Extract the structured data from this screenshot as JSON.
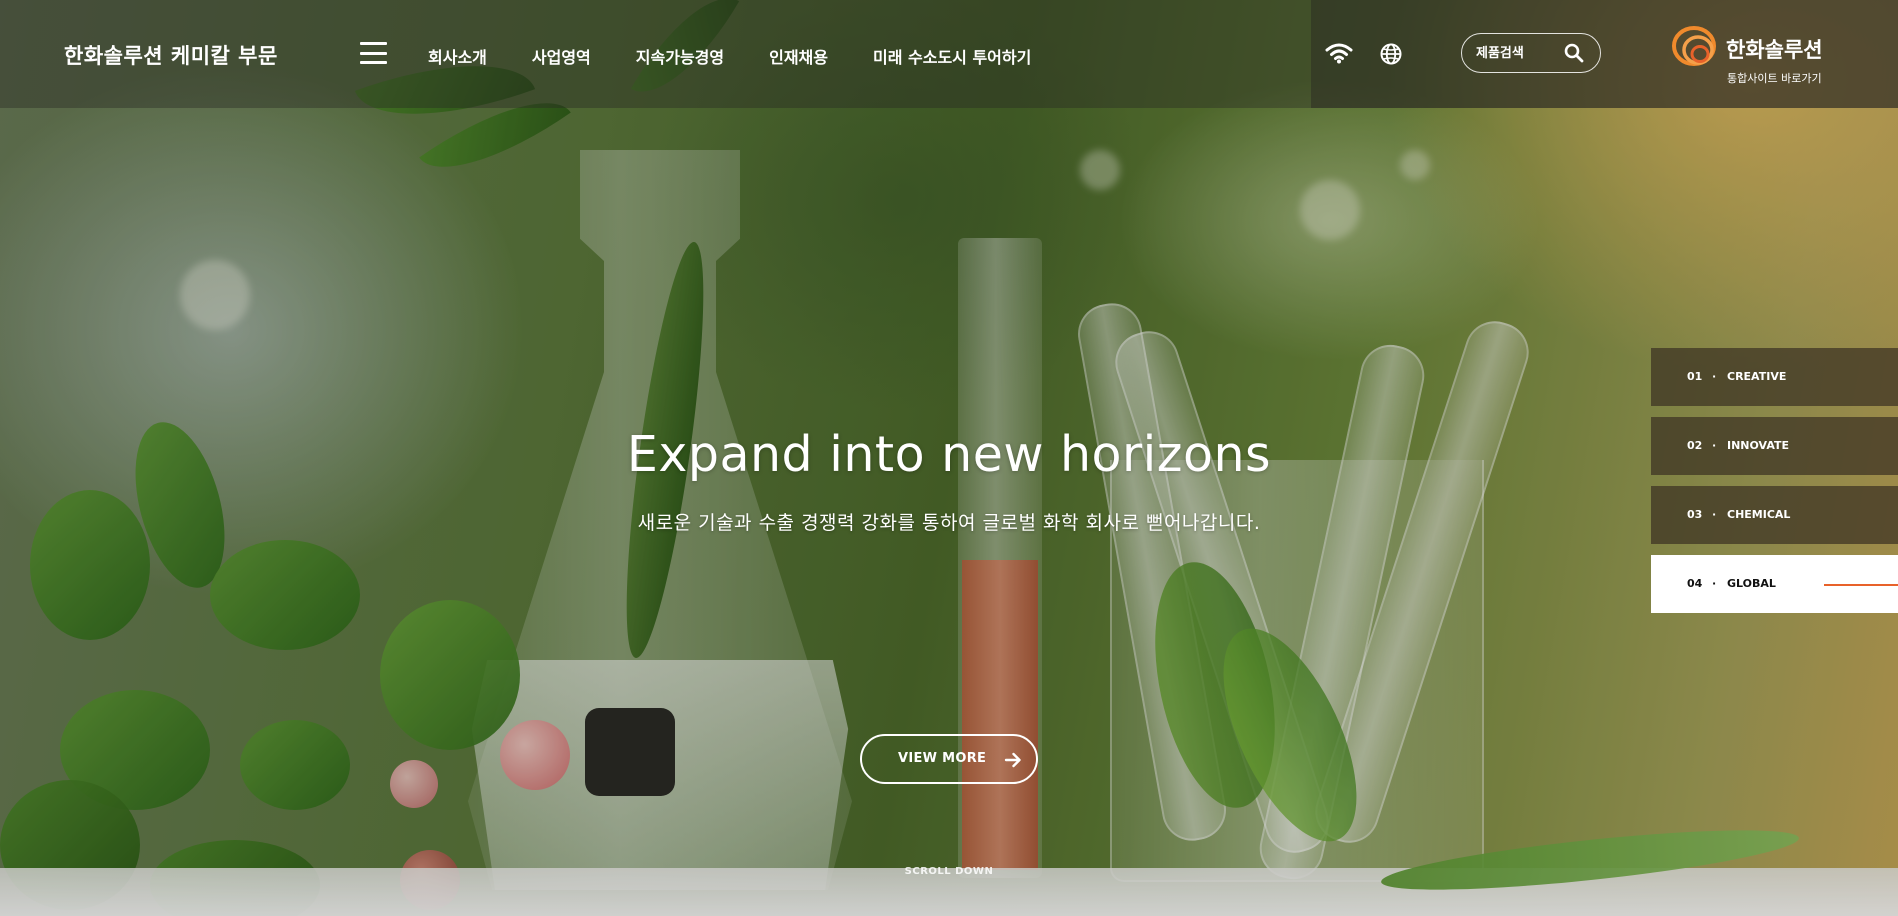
{
  "header": {
    "site_title": "한화솔루션 케미칼 부문",
    "nav": [
      {
        "label": "회사소개"
      },
      {
        "label": "사업영역"
      },
      {
        "label": "지속가능경영"
      },
      {
        "label": "인재채용"
      },
      {
        "label": "미래 수소도시 투어하기"
      }
    ],
    "search": {
      "placeholder": "제품검색"
    },
    "brand": {
      "name": "한화솔루션",
      "sub": "통합사이트 바로가기"
    }
  },
  "hero": {
    "title": "Expand into new horizons",
    "subtitle": "새로운 기술과 수출 경쟁력 강화를 통하여 글로벌 화학 회사로 뻗어나갑니다.",
    "view_more": "VIEW MORE",
    "scroll": "SCROLL DOWN"
  },
  "slides": [
    {
      "num": "01",
      "sep": "·",
      "label": "CREATIVE",
      "active": false
    },
    {
      "num": "02",
      "sep": "·",
      "label": "INNOVATE",
      "active": false
    },
    {
      "num": "03",
      "sep": "·",
      "label": "CHEMICAL",
      "active": false
    },
    {
      "num": "04",
      "sep": "·",
      "label": "GLOBAL",
      "active": true
    }
  ],
  "colors": {
    "accent": "#e8622a",
    "brand_orange": "#f08a2c",
    "tab_bg": "#3c3222"
  },
  "icons": {
    "menu": "hamburger-icon",
    "wifi": "wifi-icon",
    "globe": "globe-icon",
    "search": "search-icon",
    "arrow": "arrow-right-icon",
    "logo": "hanwha-logo-icon"
  }
}
